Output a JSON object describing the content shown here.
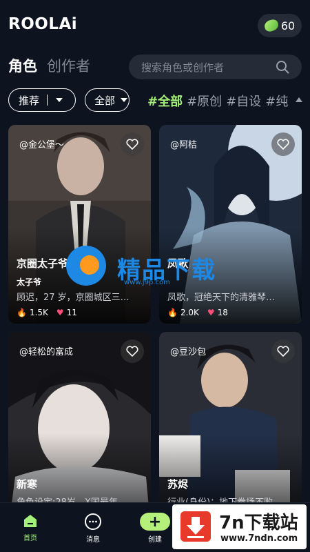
{
  "header": {
    "logo_text": "ROOLAi",
    "coins": "60"
  },
  "tabs": [
    {
      "label": "角色",
      "active": true
    },
    {
      "label": "创作者",
      "active": false
    }
  ],
  "search": {
    "placeholder": "搜索角色或创作者"
  },
  "filters": {
    "sort_label": "推荐",
    "all_label": "全部",
    "tags": [
      "#全部",
      "#原创",
      "#自设",
      "#纯"
    ]
  },
  "cards": [
    {
      "author": "@金公堡～",
      "title": "京圈太子爷",
      "subtitle": "太子爷",
      "desc": "顾迟，27 岁，京圈城区三…",
      "likes": "1.5K",
      "hearts": "11"
    },
    {
      "author": "@阿桔",
      "title": "凤歌",
      "subtitle": "",
      "desc": "凤歌，冠绝天下的清雅琴…",
      "likes": "2.0K",
      "hearts": "18"
    },
    {
      "author": "@轻松的富成",
      "title": "新寒",
      "subtitle": "",
      "desc": "角色设定:28岁，X国最年…",
      "likes": "",
      "hearts": ""
    },
    {
      "author": "@豆沙包",
      "title": "苏烬",
      "subtitle": "",
      "desc": "行业(身份)：地下拳场不败…",
      "likes": "",
      "hearts": ""
    }
  ],
  "bottom_nav": [
    {
      "label": "首页",
      "icon": "home-icon",
      "active": true
    },
    {
      "label": "消息",
      "icon": "chat-icon",
      "active": false
    },
    {
      "label": "创建",
      "icon": "plus-icon",
      "active": false
    }
  ],
  "watermarks": {
    "center_text": "精品下载",
    "center_url": "www.j9p.com",
    "badge_big": "7n下载站",
    "badge_small": "www.7ndn.com"
  },
  "colors": {
    "background": "#0d1420",
    "accent": "#a4f07a",
    "surface": "#252c38"
  }
}
